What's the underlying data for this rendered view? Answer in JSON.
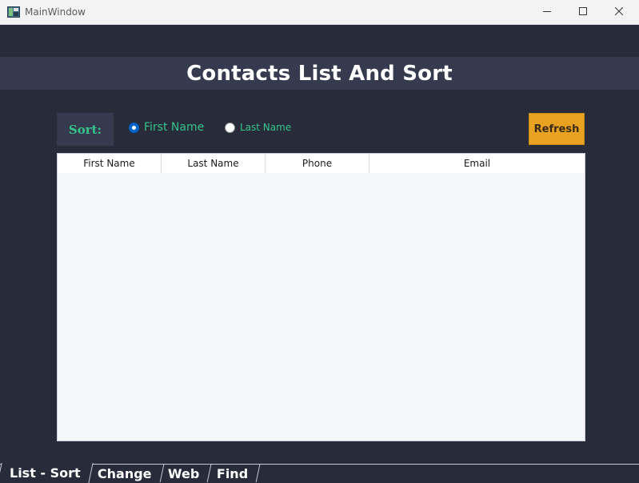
{
  "window": {
    "title": "MainWindow"
  },
  "header": {
    "title": "Contacts List And Sort"
  },
  "sort": {
    "label": "Sort:",
    "options": [
      {
        "label": "First Name",
        "checked": true
      },
      {
        "label": "Last Name",
        "checked": false
      }
    ],
    "refresh_label": "Refresh"
  },
  "table": {
    "columns": [
      "First Name",
      "Last Name",
      "Phone",
      "Email"
    ],
    "rows": []
  },
  "tabs": [
    {
      "label": "List - Sort",
      "active": true
    },
    {
      "label": "Change",
      "active": false
    },
    {
      "label": "Web",
      "active": false
    },
    {
      "label": "Find",
      "active": false
    }
  ],
  "colors": {
    "background": "#272b3a",
    "panel": "#353a4e",
    "accent_green": "#35c48a",
    "refresh_orange": "#e8a21f",
    "radio_blue": "#0063c7"
  },
  "icons": {
    "app": "app-window-icon",
    "minimize": "minimize-icon",
    "maximize": "maximize-icon",
    "close": "close-icon"
  }
}
